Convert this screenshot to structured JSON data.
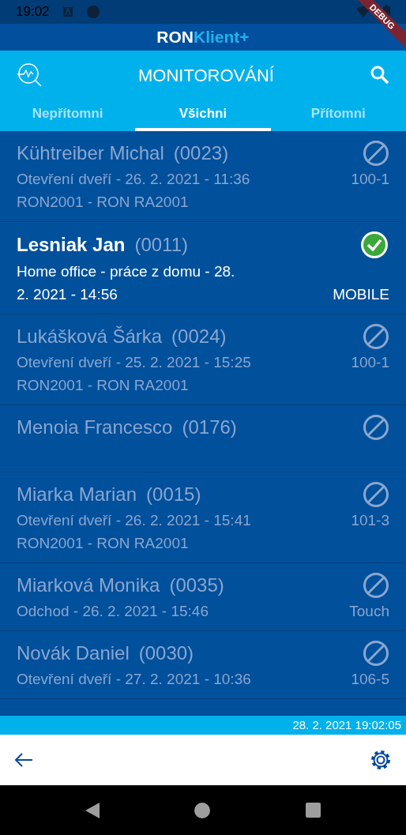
{
  "status_bar": {
    "time": "19:02"
  },
  "debug_banner": "DEBUG",
  "brand": {
    "part_1": "RON",
    "part_2": "Klient+"
  },
  "app_bar": {
    "title": "MONITOROVÁNÍ"
  },
  "tabs": [
    {
      "label": "Nepřítomni",
      "selected": false
    },
    {
      "label": "Všichni",
      "selected": true
    },
    {
      "label": "Přítomni",
      "selected": false
    }
  ],
  "people": [
    {
      "name": "Kühtreiber Michal",
      "code": "(0023)",
      "present": false,
      "event": "Otevření dveří - 26. 2. 2021 - 11:36",
      "device": "100-1",
      "reader": "RON2001 - RON RA2001"
    },
    {
      "name": "Lesniak Jan",
      "code": "(0011)",
      "present": true,
      "event": "Home office - práce z domu - 28. 2. 2021 - 14:56",
      "device": "MOBILE"
    },
    {
      "name": "Lukášková Šárka",
      "code": "(0024)",
      "present": false,
      "event": "Otevření dveří - 25. 2. 2021 - 15:25",
      "device": "100-1",
      "reader": "RON2001 - RON RA2001"
    },
    {
      "name": "Menoia Francesco",
      "code": "(0176)",
      "present": false
    },
    {
      "name": "Miarka Marian",
      "code": "(0015)",
      "present": false,
      "event": "Otevření dveří - 26. 2. 2021 - 15:41",
      "device": "101-3",
      "reader": "RON2001 - RON RA2001"
    },
    {
      "name": "Miarková Monika",
      "code": "(0035)",
      "present": false,
      "event": "Odchod - 26. 2. 2021 - 15:46",
      "device": "Touch"
    },
    {
      "name": "Novák Daniel",
      "code": "(0030)",
      "present": false,
      "event": "Otevření dveří - 27. 2. 2021 - 10:36",
      "device": "106-5"
    }
  ],
  "timestamp": "28. 2. 2021 19:02:05"
}
